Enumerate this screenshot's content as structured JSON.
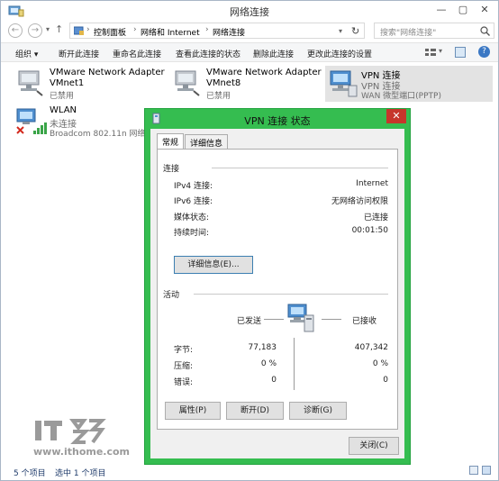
{
  "window": {
    "title": "网络连接"
  },
  "address": {
    "crumbs": [
      "控制面板",
      "网络和 Internet",
      "网络连接"
    ],
    "search_placeholder": "搜索\"网络连接\""
  },
  "commands": [
    "组织 ▾",
    "断开此连接",
    "重命名此连接",
    "查看此连接的状态",
    "删除此连接",
    "更改此连接的设置"
  ],
  "adapters": [
    {
      "name": "VMware Network Adapter",
      "line2": "VMnet1",
      "status": "已禁用"
    },
    {
      "name": "VMware Network Adapter",
      "line2": "VMnet8",
      "status": "已禁用"
    },
    {
      "name": "VPN 连接",
      "line2": "VPN 连接",
      "status": "WAN 微型端口(PPTP)"
    },
    {
      "name": "WLAN",
      "line2": "未连接",
      "status": "Broadcom 802.11n 网络适配"
    }
  ],
  "status_bar": {
    "count": "5 个项目",
    "selected": "选中 1 个项目"
  },
  "dialog": {
    "title": "VPN 连接 状态",
    "close_glyph": "✕",
    "tabs": [
      "常规",
      "详细信息"
    ],
    "connection": {
      "section": "连接",
      "rows": [
        {
          "label": "IPv4 连接:",
          "value": "Internet"
        },
        {
          "label": "IPv6 连接:",
          "value": "无网络访问权限"
        },
        {
          "label": "媒体状态:",
          "value": "已连接"
        },
        {
          "label": "持续时间:",
          "value": "00:01:50"
        }
      ],
      "details_button": "详细信息(E)..."
    },
    "activity": {
      "section": "活动",
      "sent_label": "已发送",
      "received_label": "已接收",
      "rows": [
        {
          "label": "字节:",
          "sent": "77,183",
          "received": "407,342"
        },
        {
          "label": "压缩:",
          "sent": "0 %",
          "received": "0 %"
        },
        {
          "label": "错误:",
          "sent": "0",
          "received": "0"
        }
      ]
    },
    "buttons": {
      "properties": "属性(P)",
      "disconnect": "断开(D)",
      "diagnose": "诊断(G)",
      "close": "关闭(C)"
    }
  },
  "watermark": {
    "url": "www.ithome.com"
  }
}
